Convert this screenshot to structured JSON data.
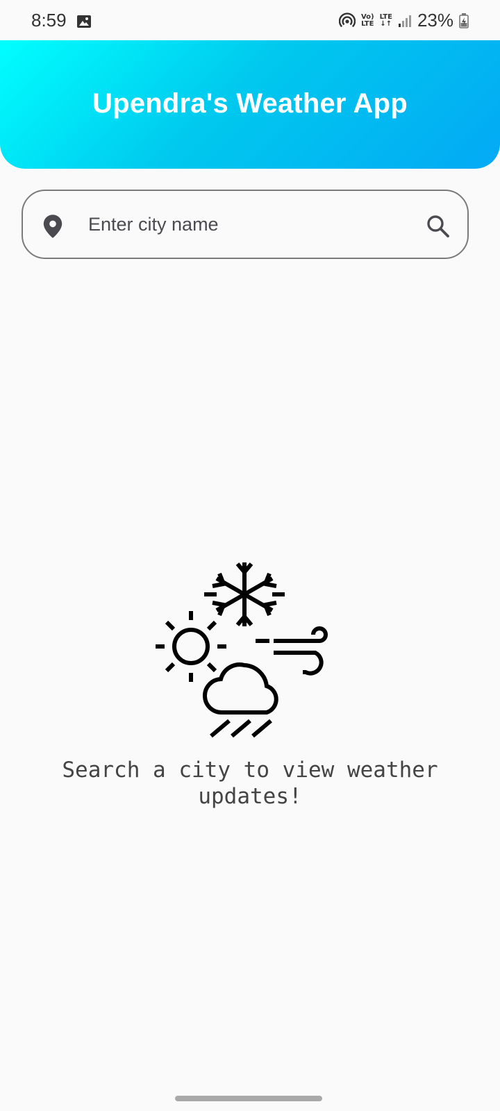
{
  "status_bar": {
    "time": "8:59",
    "network_vo_top": "Vo)",
    "network_vo_bottom": "LTE",
    "network_lte_top": "LTE",
    "network_lte_bottom": "↓↑",
    "battery_percent": "23%",
    "icons": [
      "gallery-icon",
      "hotspot-icon",
      "volte-icon",
      "lte-icon",
      "signal-icon",
      "battery-charging-icon"
    ]
  },
  "header": {
    "title": "Upendra's Weather App",
    "gradient_start": "#00ffff",
    "gradient_end": "#03a9f4",
    "title_color": "#ffffff"
  },
  "search": {
    "placeholder": "Enter city name",
    "value": "",
    "leading_icon": "location-pin-icon",
    "trailing_icon": "search-icon"
  },
  "empty_state": {
    "illustration": "weather-mixed-icon",
    "message": "Search a city to view weather updates!"
  }
}
